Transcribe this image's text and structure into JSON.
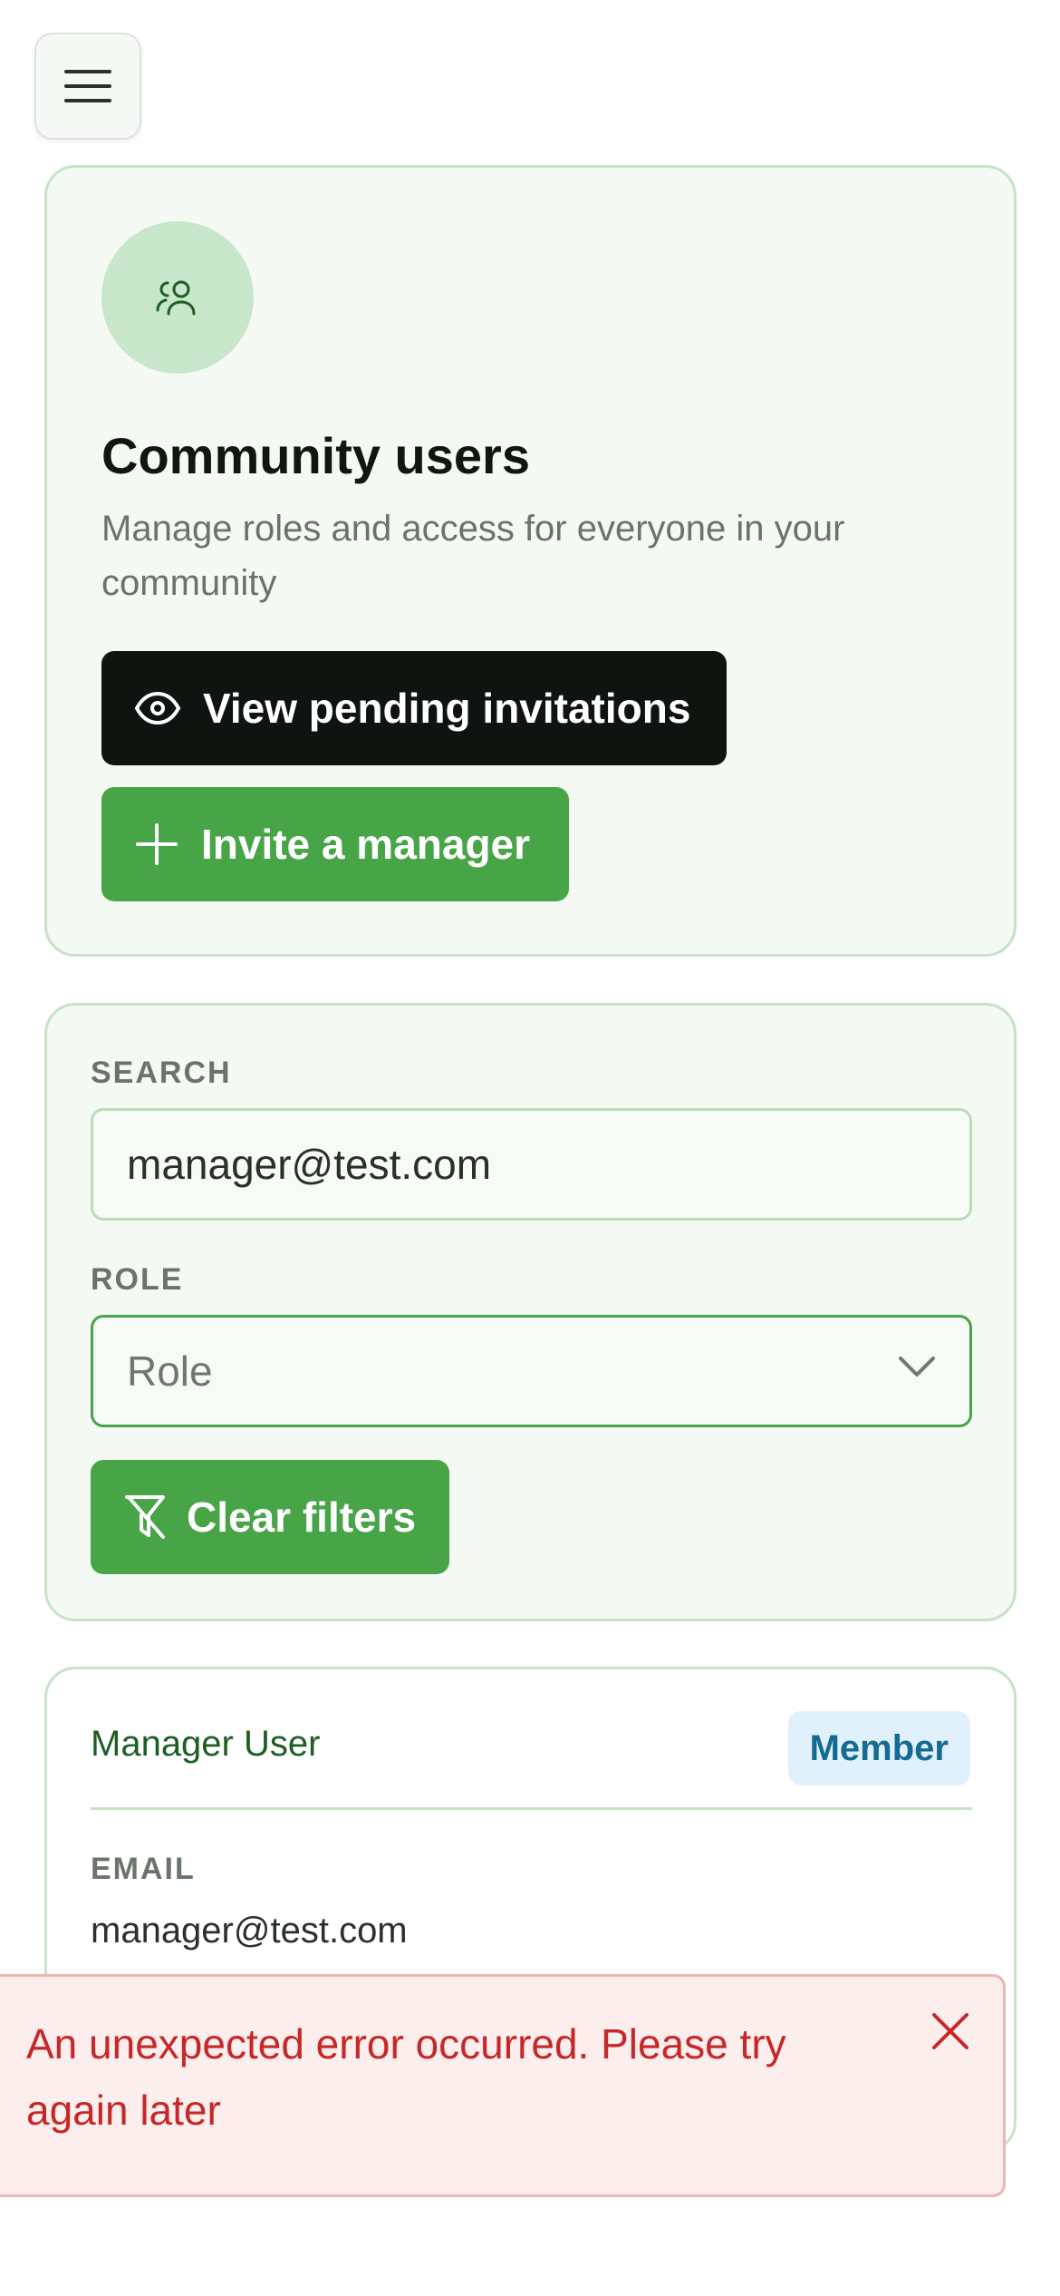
{
  "header": {
    "menu_icon": "hamburger-menu-icon"
  },
  "hero": {
    "icon": "users-icon",
    "title": "Community users",
    "subtitle": "Manage roles and access for everyone in your community",
    "view_invitations_label": "View pending invitations",
    "invite_manager_label": "Invite a manager"
  },
  "filters": {
    "search_label": "SEARCH",
    "search_value": "manager@test.com",
    "role_label": "ROLE",
    "role_placeholder": "Role",
    "clear_label": "Clear filters"
  },
  "user_card": {
    "name": "Manager User",
    "badge": "Member",
    "email_label": "EMAIL",
    "email": "manager@test.com"
  },
  "toast": {
    "message": "An unexpected error occurred. Please try again later"
  },
  "colors": {
    "accent_green": "#47a447",
    "dark_button": "#0f1410",
    "error_red": "#c62828",
    "badge_blue": "#146a94"
  }
}
